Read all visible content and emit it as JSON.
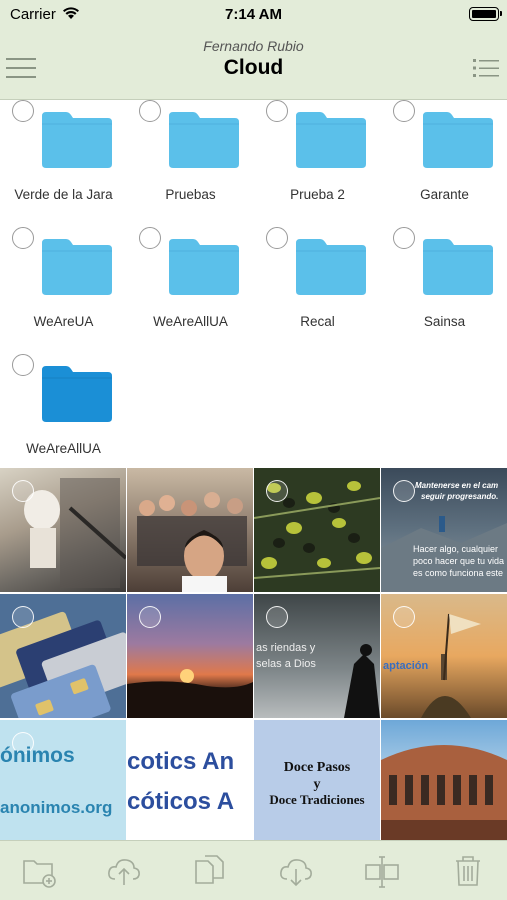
{
  "status_bar": {
    "carrier": "Carrier",
    "time": "7:14 AM"
  },
  "nav": {
    "subtitle": "Fernando Rubio",
    "title": "Cloud"
  },
  "folders": [
    {
      "name": "Verde de la Jara"
    },
    {
      "name": "Pruebas"
    },
    {
      "name": "Prueba 2"
    },
    {
      "name": "Garante"
    },
    {
      "name": "WeAreUA"
    },
    {
      "name": "WeAreAllUA"
    },
    {
      "name": "Recal"
    },
    {
      "name": "Sainsa"
    },
    {
      "name": "WeAreAllUA"
    }
  ],
  "photos": {
    "quote1_line1": "Mantenerse en el cam",
    "quote1_line2": "seguir progresando.",
    "quote1_line3": "Hacer algo, cualquier",
    "quote1_line4": "poco hacer que tu vida",
    "quote1_line5": "es como funciona este",
    "quote2_line1": "as riendas y",
    "quote2_line2": "selas a Dios",
    "quote3_line1": "aptación",
    "logo1_line1": "ónimos",
    "logo1_line2": "anonimos.org",
    "logo2_line1": "cotics An",
    "logo2_line2": "cóticos A",
    "book_line1": "Doce Pasos",
    "book_line2": "y",
    "book_line3": "Doce Tradiciones"
  },
  "colors": {
    "bar_background": "#e3ecd9",
    "folder_blue": "#5bc0ea",
    "folder_blue_dark": "#1b8fd6",
    "icon_gray": "#a3ac9b"
  },
  "toolbar_icons": [
    "new-folder-icon",
    "cloud-upload-icon",
    "copy-icon",
    "cloud-download-icon",
    "move-icon",
    "trash-icon"
  ]
}
